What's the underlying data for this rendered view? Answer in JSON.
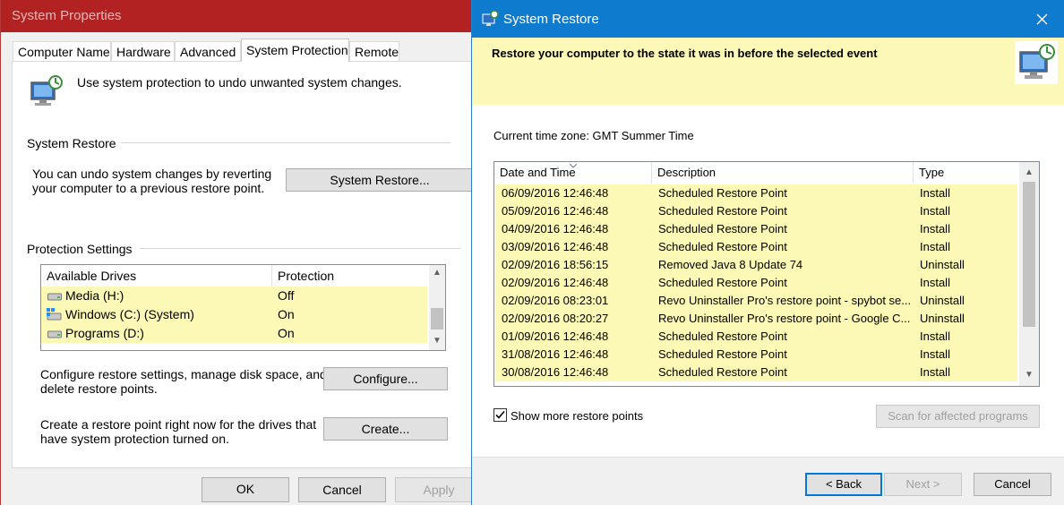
{
  "system_properties": {
    "title": "System Properties",
    "tabs": [
      "Computer Name",
      "Hardware",
      "Advanced",
      "System Protection",
      "Remote"
    ],
    "active_tab": "System Protection",
    "intro": "Use system protection to undo unwanted system changes.",
    "system_restore_section": {
      "heading": "System Restore",
      "description_line1": "You can undo system changes by reverting",
      "description_line2": "your computer to a previous restore point.",
      "button": "System Restore..."
    },
    "protection_settings": {
      "heading": "Protection Settings",
      "columns": [
        "Available Drives",
        "Protection"
      ],
      "drives": [
        {
          "name": "Media (H:)",
          "protection": "Off",
          "icon": "drive-icon"
        },
        {
          "name": "Windows (C:) (System)",
          "protection": "On",
          "icon": "windows-drive-icon"
        },
        {
          "name": "Programs (D:)",
          "protection": "On",
          "icon": "drive-icon"
        }
      ],
      "configure_text_line1": "Configure restore settings, manage disk space, and",
      "configure_text_line2": "delete restore points.",
      "configure_button": "Configure...",
      "create_text_line1": "Create a restore point right now for the drives that",
      "create_text_line2": "have system protection turned on.",
      "create_button": "Create..."
    },
    "footer": {
      "ok": "OK",
      "cancel": "Cancel",
      "apply": "Apply"
    }
  },
  "system_restore": {
    "title": "System Restore",
    "banner": "Restore your computer to the state it was in before the selected event",
    "timezone": "Current time zone: GMT Summer Time",
    "columns": [
      "Date and Time",
      "Description",
      "Type"
    ],
    "restore_points": [
      {
        "date": "06/09/2016 12:46:48",
        "description": "Scheduled Restore Point",
        "type": "Install"
      },
      {
        "date": "05/09/2016 12:46:48",
        "description": "Scheduled Restore Point",
        "type": "Install"
      },
      {
        "date": "04/09/2016 12:46:48",
        "description": "Scheduled Restore Point",
        "type": "Install"
      },
      {
        "date": "03/09/2016 12:46:48",
        "description": "Scheduled Restore Point",
        "type": "Install"
      },
      {
        "date": "02/09/2016 18:56:15",
        "description": "Removed Java 8 Update 74",
        "type": "Uninstall"
      },
      {
        "date": "02/09/2016 12:46:48",
        "description": "Scheduled Restore Point",
        "type": "Install"
      },
      {
        "date": "02/09/2016 08:23:01",
        "description": "Revo Uninstaller Pro's restore point - spybot se...",
        "type": "Uninstall"
      },
      {
        "date": "02/09/2016 08:20:27",
        "description": "Revo Uninstaller Pro's restore point - Google C...",
        "type": "Uninstall"
      },
      {
        "date": "01/09/2016 12:46:48",
        "description": "Scheduled Restore Point",
        "type": "Install"
      },
      {
        "date": "31/08/2016 12:46:48",
        "description": "Scheduled Restore Point",
        "type": "Install"
      },
      {
        "date": "30/08/2016 12:46:48",
        "description": "Scheduled Restore Point",
        "type": "Install"
      }
    ],
    "show_more_label": "Show more restore points",
    "show_more_checked": true,
    "scan_button": "Scan for affected programs",
    "footer": {
      "back": "< Back",
      "next": "Next >",
      "cancel": "Cancel"
    }
  },
  "colors": {
    "sp_titlebar": "#b22222",
    "sr_titlebar": "#0f7bcf",
    "highlight_row": "#fcf8b5",
    "accent": "#0078d7"
  }
}
